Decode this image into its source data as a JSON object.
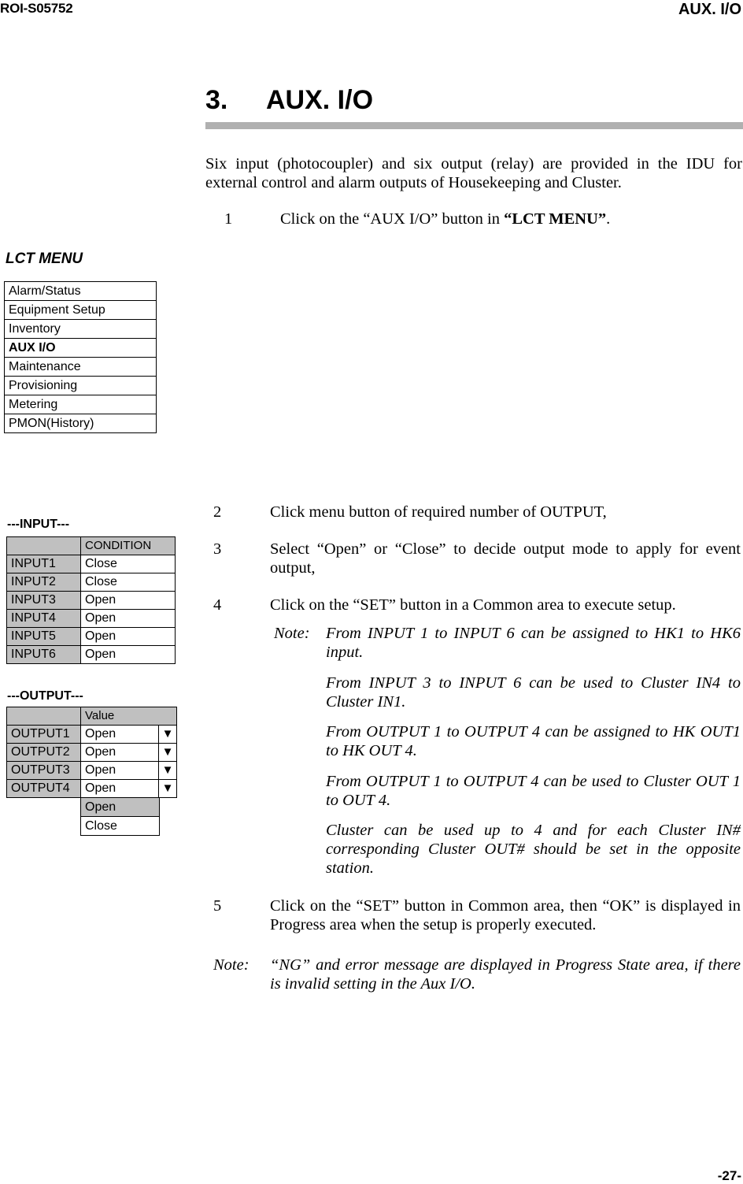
{
  "header": {
    "doc_id": "ROI-S05752",
    "section": "AUX. I/O"
  },
  "section": {
    "number": "3.",
    "title": "AUX. I/O"
  },
  "intro": "Six input (photocoupler) and six output (relay) are provided in the IDU for external control and alarm outputs of Housekeeping and Cluster.",
  "steps": [
    {
      "num": "1",
      "text_before": "Click on the “AUX I/O” button in ",
      "text_bold": "“LCT MENU”",
      "text_after": "."
    },
    {
      "num": "2",
      "text": "Click menu button of required number of OUTPUT,"
    },
    {
      "num": "3",
      "text": "Select “Open” or “Close” to decide output mode to apply for event output,"
    },
    {
      "num": "4",
      "text": "Click on the “SET” button in a Common area to execute setup."
    },
    {
      "num": "5",
      "text": "Click on the “SET” button in Common area, then “OK” is displayed in Progress area when the setup is properly executed."
    }
  ],
  "step4_notes": {
    "label": "Note:",
    "items": [
      "From INPUT 1 to INPUT 6 can be assigned to HK1 to HK6 input.",
      "From INPUT 3 to INPUT 6 can be used to Cluster IN4 to Cluster IN1.",
      "From OUTPUT 1 to OUTPUT 4 can be assigned to HK OUT1 to HK OUT 4.",
      "From OUTPUT 1 to OUTPUT 4 can be used to Cluster OUT 1 to OUT 4.",
      "Cluster can be used up to 4 and for each Cluster IN# corresponding Cluster OUT# should be set in the opposite station."
    ]
  },
  "final_note": {
    "label": "Note:",
    "text": "“NG” and error message are displayed in Progress State area, if there is invalid setting in the Aux I/O."
  },
  "lct_menu": {
    "title": "LCT MENU",
    "items": [
      {
        "label": "Alarm/Status"
      },
      {
        "label": "Equipment Setup"
      },
      {
        "label": "Inventory"
      },
      {
        "label": "AUX I/O",
        "active": true
      },
      {
        "label": "Maintenance"
      },
      {
        "label": "Provisioning"
      },
      {
        "label": "Metering"
      },
      {
        "label": "PMON(History)"
      }
    ]
  },
  "input_block": {
    "title": "---INPUT---",
    "column_header": "CONDITION",
    "rows": [
      {
        "name": "INPUT1",
        "condition": "Close"
      },
      {
        "name": "INPUT2",
        "condition": "Close"
      },
      {
        "name": "INPUT3",
        "condition": "Open"
      },
      {
        "name": "INPUT4",
        "condition": "Open"
      },
      {
        "name": "INPUT5",
        "condition": "Open"
      },
      {
        "name": "INPUT6",
        "condition": "Open"
      }
    ]
  },
  "output_block": {
    "title": "---OUTPUT---",
    "column_header": "Value",
    "arrow_glyph": "▼",
    "rows": [
      {
        "name": "OUTPUT1",
        "value": "Open"
      },
      {
        "name": "OUTPUT2",
        "value": "Open"
      },
      {
        "name": "OUTPUT3",
        "value": "Open"
      },
      {
        "name": "OUTPUT4",
        "value": "Open"
      }
    ],
    "dropdown_options": [
      {
        "label": "Open",
        "selected": true
      },
      {
        "label": "Close"
      }
    ]
  },
  "footer": {
    "page_number": "-27-"
  }
}
